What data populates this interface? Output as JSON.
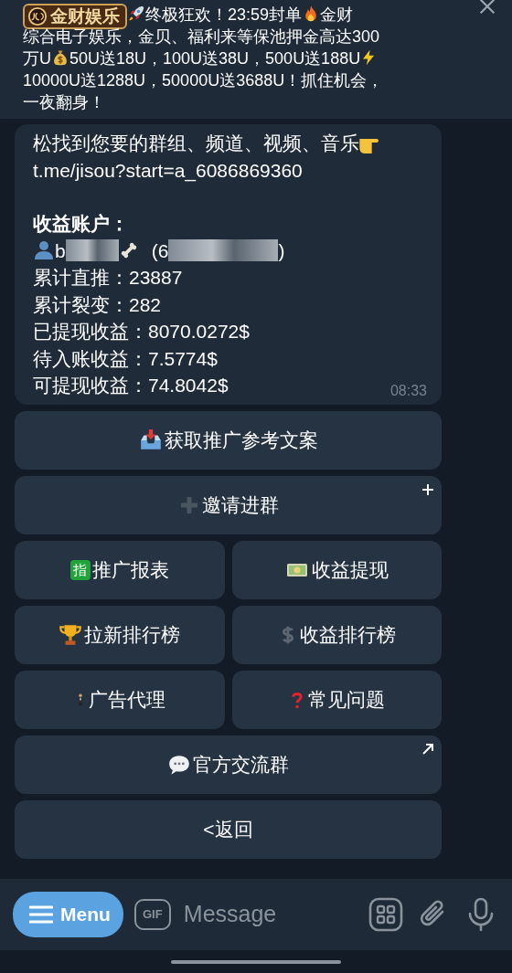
{
  "pinned": {
    "logo": "金财娱乐",
    "lines": [
      [
        "终极狂欢！23:59封单",
        "金财"
      ],
      [
        "综合电子娱乐，金贝、福利来等保池押金高达300"
      ],
      [
        "万U",
        "50U送18U，100U送38U，500U送188U"
      ],
      [
        "10000U送1288U，50000U送3688U！抓住机会，"
      ],
      [
        "一夜翻身！"
      ]
    ]
  },
  "message": {
    "cut_line": "松找到您要的群组、频道、视频、音乐",
    "link_line": "t.me/jisou?start=a_6086869360",
    "account_title": "收益账户：",
    "user": {
      "name_start": "b",
      "id_start": "(6",
      "id_end": ")"
    },
    "stats": [
      "累计直推：23887",
      "累计裂变：282",
      "已提现收益：8070.0272$",
      "待入账收益：7.5774$",
      "可提现收益：74.8042$"
    ],
    "time": "08:33"
  },
  "keyboard": [
    {
      "buttons": [
        {
          "label": "获取推广参考文案",
          "kind": "plain"
        }
      ]
    },
    {
      "buttons": [
        {
          "label": "邀请进群",
          "kind": "add"
        }
      ]
    },
    {
      "buttons": [
        {
          "label": "推广报表",
          "badge": "指",
          "kind": "plain"
        },
        {
          "label": "收益提现",
          "kind": "plain"
        }
      ]
    },
    {
      "buttons": [
        {
          "label": "拉新排行榜",
          "kind": "plain"
        },
        {
          "label": "收益排行榜",
          "kind": "plain"
        }
      ]
    },
    {
      "buttons": [
        {
          "label": "广告代理",
          "kind": "plain"
        },
        {
          "label": "常见问题",
          "kind": "plain"
        }
      ]
    },
    {
      "buttons": [
        {
          "label": "官方交流群",
          "kind": "external"
        }
      ]
    },
    {
      "buttons": [
        {
          "label": "<返回",
          "kind": "plain"
        }
      ]
    }
  ],
  "input_bar": {
    "menu": "Menu",
    "gif": "GIF",
    "placeholder": "Message"
  }
}
